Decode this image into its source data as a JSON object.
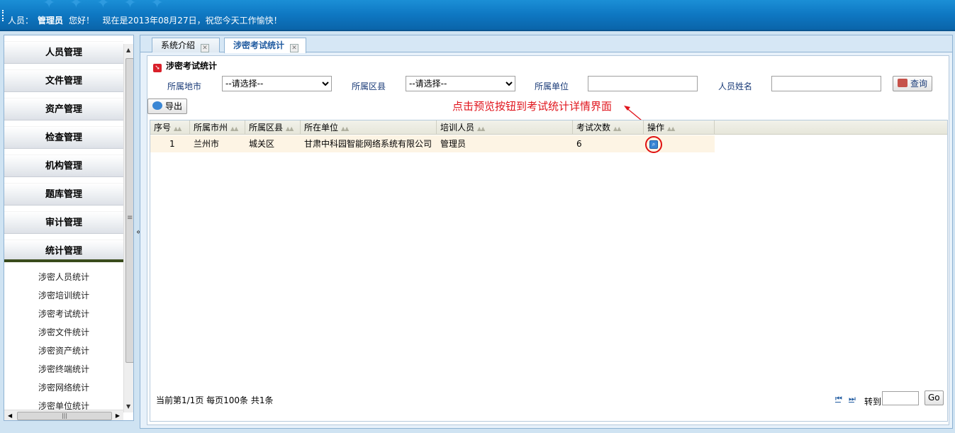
{
  "header": {
    "user_label": "人员：",
    "user_name": "管理员",
    "greeting": "您好！",
    "date_text": "现在是2013年08月27日，祝您今天工作愉快！"
  },
  "sidebar": {
    "menu": [
      "人员管理",
      "文件管理",
      "资产管理",
      "检查管理",
      "机构管理",
      "题库管理",
      "审计管理",
      "统计管理"
    ],
    "submenu": [
      "涉密人员统计",
      "涉密培训统计",
      "涉密考试统计",
      "涉密文件统计",
      "涉密资产统计",
      "涉密终端统计",
      "涉密网络统计",
      "涉密单位统计"
    ]
  },
  "tabs": {
    "tab1": "系统介绍",
    "tab2": "涉密考试统计"
  },
  "panel": {
    "title": "涉密考试统计",
    "filters": {
      "city_label": "所属地市",
      "city_value": "--请选择--",
      "county_label": "所属区县",
      "county_value": "--请选择--",
      "unit_label": "所属单位",
      "unit_value": "",
      "name_label": "人员姓名",
      "name_value": ""
    },
    "search_button": "查询",
    "export_button": "导出"
  },
  "annotation": "点击预览按钮到考试统计详情界面",
  "table": {
    "headers": [
      "序号",
      "所属市州",
      "所属区县",
      "所在单位",
      "培训人员",
      "考试次数",
      "操作"
    ],
    "rows": [
      {
        "index": "1",
        "city": "兰州市",
        "county": "城关区",
        "unit": "甘肃中科园智能网络系统有限公司",
        "person": "管理员",
        "count": "6"
      }
    ]
  },
  "pager": {
    "info": "当前第1/1页  每页100条  共1条",
    "first": "⏮",
    "last": "⏭",
    "jump_label": "转到",
    "go_button": "Go"
  },
  "colors": {
    "header_blue": "#0e77c2",
    "annotation_red": "#e0141c",
    "row_highlight": "#fdf4e4"
  }
}
